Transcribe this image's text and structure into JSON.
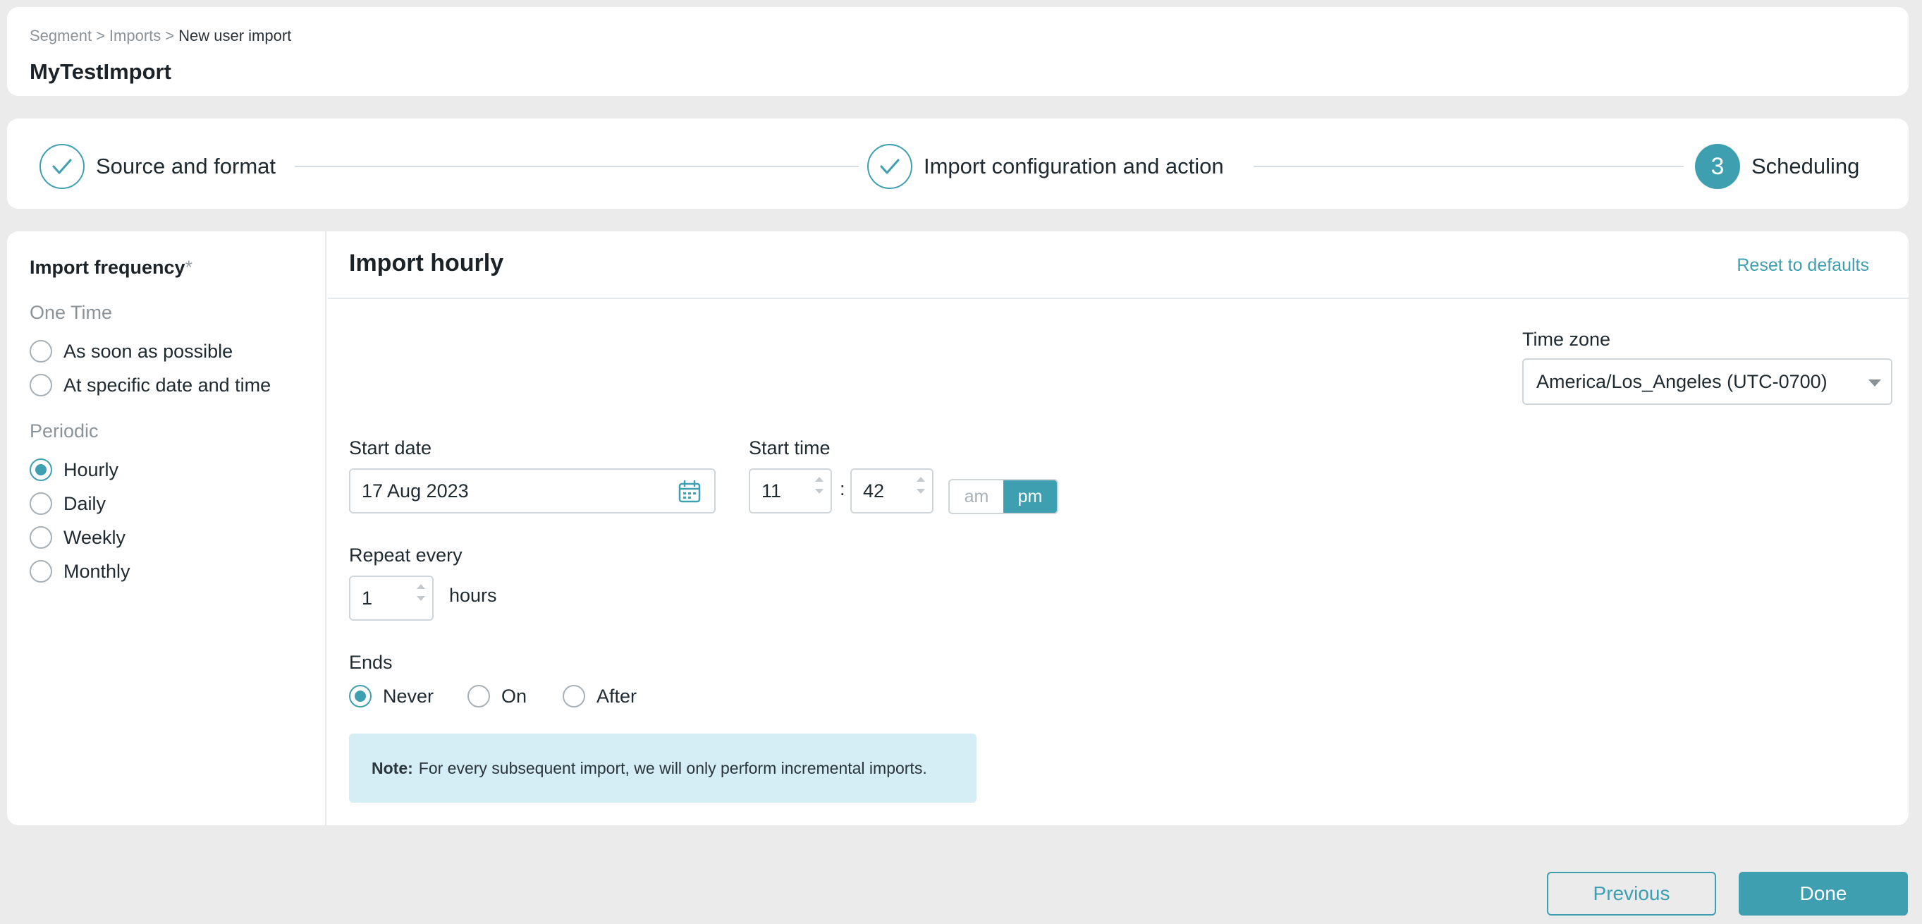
{
  "header": {
    "breadcrumb": [
      {
        "label": "Segment"
      },
      {
        "label": ">"
      },
      {
        "label": "Imports"
      },
      {
        "label": ">"
      },
      {
        "label": "New user import"
      }
    ],
    "title": "MyTestImport"
  },
  "stepper": {
    "steps": [
      {
        "label": "Source and format",
        "state": "done",
        "icon": "check-icon"
      },
      {
        "label": "Import configuration and action",
        "state": "done",
        "icon": "check-icon"
      },
      {
        "label": "Scheduling",
        "state": "active",
        "number": "3"
      }
    ]
  },
  "sidebar": {
    "title": "Import frequency",
    "required_mark": "*",
    "one_time": {
      "section_label": "One Time",
      "options": [
        {
          "label": "As soon as possible",
          "checked": false
        },
        {
          "label": "At specific date and time",
          "checked": false
        }
      ]
    },
    "periodic": {
      "section_label": "Periodic",
      "options": [
        {
          "label": "Hourly",
          "checked": true
        },
        {
          "label": "Daily",
          "checked": false
        },
        {
          "label": "Weekly",
          "checked": false
        },
        {
          "label": "Monthly",
          "checked": false
        }
      ]
    }
  },
  "content": {
    "title": "Import hourly",
    "reset_label": "Reset to defaults",
    "time_zone": {
      "label": "Time zone",
      "value": "America/Los_Angeles (UTC-0700)"
    },
    "start_date": {
      "label": "Start date",
      "value": "17 Aug 2023",
      "icon": "calendar-icon"
    },
    "start_time": {
      "label": "Start time",
      "hour": "11",
      "separator": ":",
      "minute": "42",
      "am_label": "am",
      "pm_label": "pm",
      "selected": "pm"
    },
    "repeat": {
      "label": "Repeat every",
      "value": "1",
      "unit": "hours"
    },
    "ends": {
      "label": "Ends",
      "options": [
        {
          "label": "Never",
          "checked": true
        },
        {
          "label": "On",
          "checked": false
        },
        {
          "label": "After",
          "checked": false
        }
      ]
    },
    "note": {
      "prefix": "Note:",
      "text": "For every subsequent import, we will only perform incremental imports."
    }
  },
  "footer": {
    "previous_label": "Previous",
    "done_label": "Done"
  },
  "colors": {
    "accent": "#3e9fb0",
    "note_bg": "#d5edf4",
    "page_bg": "#ebebeb"
  }
}
